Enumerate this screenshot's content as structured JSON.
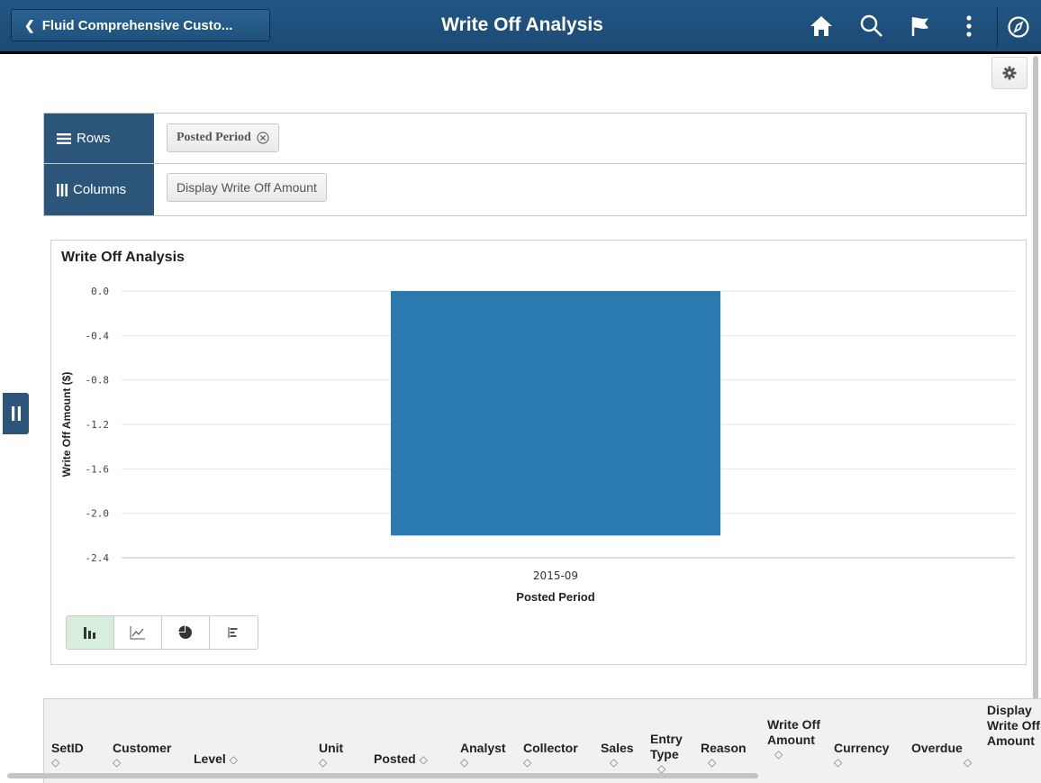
{
  "header": {
    "back_label": "Fluid Comprehensive Custo...",
    "title": "Write Off Analysis",
    "icons": [
      "home-icon",
      "search-icon",
      "flag-icon",
      "more-icon",
      "navigator-icon"
    ]
  },
  "pivot": {
    "rows_label": "Rows",
    "columns_label": "Columns",
    "row_chip": "Posted Period",
    "column_chip": "Display Write Off Amount"
  },
  "chart_data": {
    "type": "bar",
    "title": "Write Off Analysis",
    "xlabel": "Posted Period",
    "ylabel": "Write Off Amount ($)",
    "categories": [
      "2015-09"
    ],
    "values": [
      -2.2
    ],
    "ylim": [
      -2.4,
      0.0
    ],
    "yticks": [
      "0.0",
      "-0.4",
      "-0.8",
      "-1.2",
      "-1.6",
      "-2.0",
      "-2.4"
    ],
    "grid": true,
    "bar_color": "#2a7ab0"
  },
  "chart_tools": [
    "bar-chart-icon",
    "line-chart-icon",
    "pie-chart-icon",
    "horizontal-bar-icon"
  ],
  "grid": {
    "columns": [
      {
        "label": "SetID"
      },
      {
        "label": "Customer"
      },
      {
        "label": "Level"
      },
      {
        "label": "Unit"
      },
      {
        "label": "Posted"
      },
      {
        "label": "Analyst"
      },
      {
        "label": "Collector"
      },
      {
        "label": "Sales"
      },
      {
        "label": "Entry Type"
      },
      {
        "label": "Reason"
      },
      {
        "label": "Write Off Amount"
      },
      {
        "label": "Currency"
      },
      {
        "label": "Overdue"
      },
      {
        "label": "Display Write Off Amount"
      }
    ]
  },
  "colors": {
    "header_bg": "#215683",
    "accent": "#2b5579",
    "bar": "#2a7ab0",
    "active_tool": "#d6eedb"
  }
}
